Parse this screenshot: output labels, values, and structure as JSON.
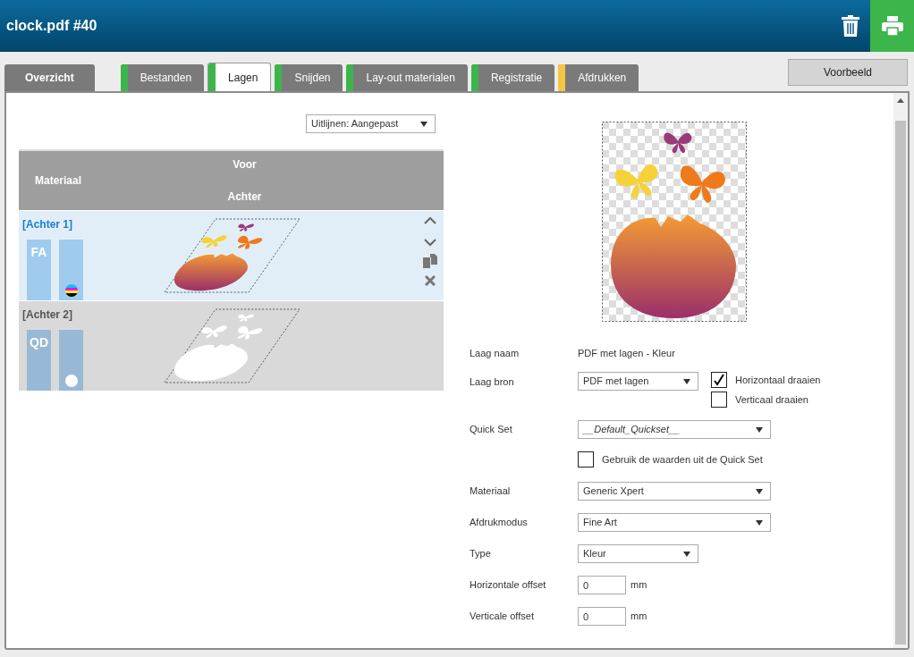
{
  "window": {
    "title": "clock.pdf #40"
  },
  "tabs": [
    {
      "label": "Overzicht",
      "selected": false
    },
    {
      "label": "Bestanden",
      "selected": false,
      "color": "#3cb54a"
    },
    {
      "label": "Lagen",
      "selected": true,
      "color": "#3cb54a"
    },
    {
      "label": "Snijden",
      "selected": false,
      "color": "#3cb54a"
    },
    {
      "label": "Lay-out materialen",
      "selected": false,
      "color": "#3cb54a"
    },
    {
      "label": "Registratie",
      "selected": false,
      "color": "#3cb54a"
    },
    {
      "label": "Afdrukken",
      "selected": false,
      "color": "#f4c542"
    }
  ],
  "preview_tab": {
    "label": "Voorbeeld"
  },
  "align_select": {
    "value": "Uitlijnen: Aangepast"
  },
  "layers_table": {
    "columns": {
      "material": "Materiaal",
      "front": "Voor",
      "back": "Achter"
    },
    "rows": [
      {
        "name": "[Achter 1]",
        "selected": true,
        "material": "FA",
        "kind": "color"
      },
      {
        "name": "[Achter 2]",
        "selected": false,
        "material": "QD",
        "kind": "white"
      }
    ]
  },
  "form": {
    "layer_name": {
      "label": "Laag naam",
      "value": "PDF met lagen - Kleur"
    },
    "layer_source": {
      "label": "Laag bron",
      "value": "PDF met lagen"
    },
    "flips": [
      {
        "label": "Horizontaal draaien",
        "checked": true
      },
      {
        "label": "Verticaal draaien",
        "checked": false
      }
    ],
    "quick_set": {
      "label": "Quick Set",
      "value": "__Default_Quickset__"
    },
    "use_quickset": {
      "label": "Gebruik de waarden uit de Quick Set",
      "checked": false
    },
    "selects": [
      {
        "label": "Materiaal",
        "value": "Generic Xpert",
        "wide": true
      },
      {
        "label": "Afdrukmodus",
        "value": "Fine Art",
        "wide": true
      },
      {
        "label": "Type",
        "value": "Kleur",
        "wide": false
      }
    ],
    "offsets": [
      {
        "label": "Horizontale offset",
        "value": "0",
        "unit": "mm"
      },
      {
        "label": "Verticale offset",
        "value": "0",
        "unit": "mm"
      }
    ]
  }
}
